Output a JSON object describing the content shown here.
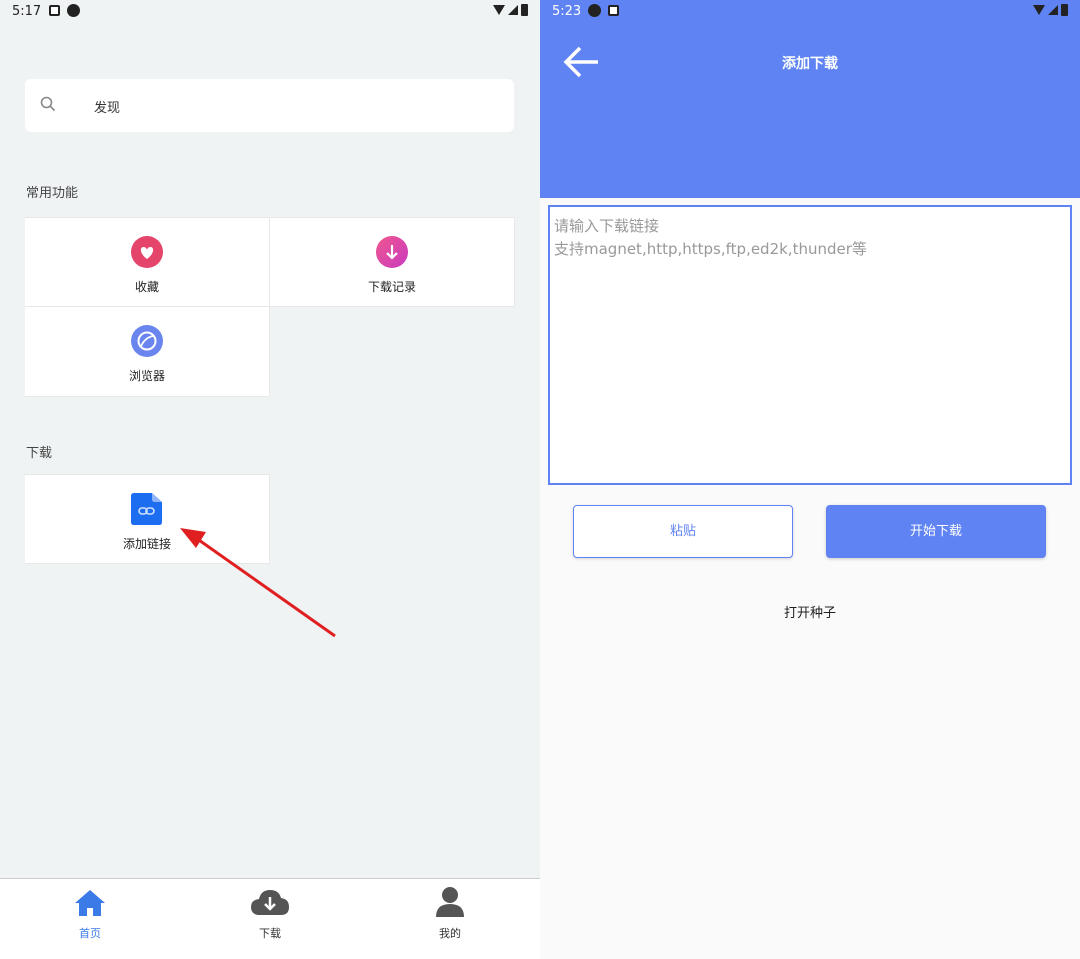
{
  "left": {
    "status": {
      "time": "5:17"
    },
    "search": {
      "placeholder": "发现"
    },
    "sections": {
      "common": "常用功能",
      "download": "下载"
    },
    "tiles": {
      "favorites": "收藏",
      "download_history": "下载记录",
      "browser": "浏览器",
      "add_link": "添加链接"
    },
    "nav": {
      "home": "首页",
      "download": "下载",
      "mine": "我的"
    },
    "colors": {
      "active": "#3b7be8",
      "inactive": "#333333"
    }
  },
  "right": {
    "status": {
      "time": "5:23"
    },
    "title": "添加下载",
    "input": {
      "placeholder_line1": "请输入下载链接",
      "placeholder_line2": "支持magnet,http,https,ftp,ed2k,thunder等"
    },
    "buttons": {
      "paste": "粘贴",
      "start": "开始下载"
    },
    "open_torrent": "打开种子",
    "colors": {
      "accent": "#5f83f2"
    }
  }
}
